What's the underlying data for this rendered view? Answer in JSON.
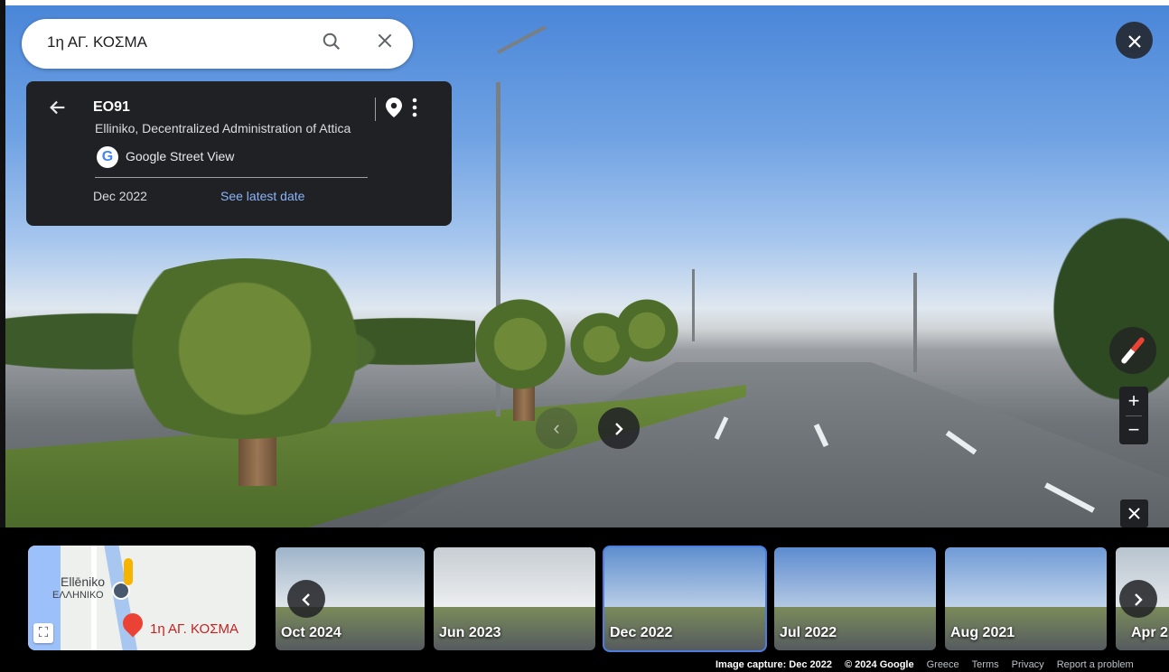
{
  "search": {
    "query": "1η ΑΓ. ΚΟΣΜΑ"
  },
  "info_card": {
    "title": "ΕΟ91",
    "subtitle": "Elliniko, Decentralized Administration of Attica",
    "source": "Google Street View",
    "capture_date": "Dec 2022",
    "latest_link": "See latest date"
  },
  "minimap": {
    "place_name": "Ellēniko",
    "place_name_greek": "ΕΛΛΗΝΙΚΟ",
    "pin_label": "1η ΑΓ. ΚΟΣΜΑ"
  },
  "timeline": [
    {
      "label": "Oct 2024",
      "selected": false
    },
    {
      "label": "Jun 2023",
      "selected": false
    },
    {
      "label": "Dec 2022",
      "selected": true
    },
    {
      "label": "Jul 2022",
      "selected": false
    },
    {
      "label": "Aug 2021",
      "selected": false
    },
    {
      "label": "Apr 2",
      "selected": false
    }
  ],
  "footer": {
    "image_capture": "Image capture: Dec 2022",
    "copyright": "© 2024 Google",
    "region": "Greece",
    "terms": "Terms",
    "privacy": "Privacy",
    "report": "Report a problem"
  },
  "icons": {
    "search": "search-icon",
    "clear": "close-icon",
    "back": "arrow-back-icon",
    "pin": "location-pin-icon",
    "more": "more-vert-icon",
    "close": "close-icon",
    "compass": "compass-icon",
    "zoom_in": "plus-icon",
    "zoom_out": "minus-icon",
    "expand": "fullscreen-icon"
  },
  "colors": {
    "accent": "#4a7fe0",
    "link": "#8ab4f8",
    "card_bg": "#202124",
    "pin_red": "#ea4335"
  }
}
